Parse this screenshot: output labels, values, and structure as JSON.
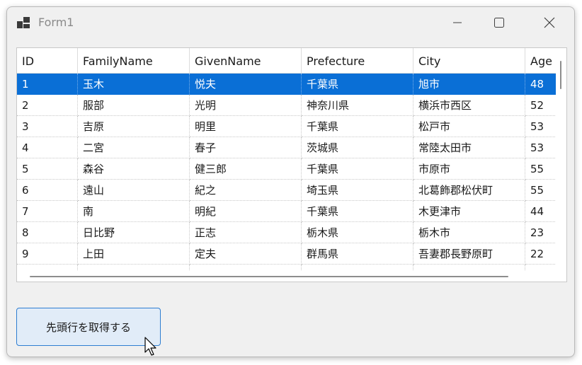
{
  "window": {
    "title": "Form1",
    "controls": [
      "minimize-icon",
      "maximize-icon",
      "close-icon"
    ]
  },
  "grid": {
    "columns": [
      "ID",
      "FamilyName",
      "GivenName",
      "Prefecture",
      "City",
      "Age"
    ],
    "selected_row_index": 0,
    "rows": [
      [
        "1",
        "玉木",
        "悦夫",
        "千葉県",
        "旭市",
        "48"
      ],
      [
        "2",
        "服部",
        "光明",
        "神奈川県",
        "横浜市西区",
        "52"
      ],
      [
        "3",
        "吉原",
        "明里",
        "千葉県",
        "松戸市",
        "53"
      ],
      [
        "4",
        "二宮",
        "春子",
        "茨城県",
        "常陸太田市",
        "53"
      ],
      [
        "5",
        "森谷",
        "健三郎",
        "千葉県",
        "市原市",
        "55"
      ],
      [
        "6",
        "遠山",
        "紀之",
        "埼玉県",
        "北葛飾郡松伏町",
        "55"
      ],
      [
        "7",
        "南",
        "明紀",
        "千葉県",
        "木更津市",
        "44"
      ],
      [
        "8",
        "日比野",
        "正志",
        "栃木県",
        "栃木市",
        "23"
      ],
      [
        "9",
        "上田",
        "定夫",
        "群馬県",
        "吾妻郡長野原町",
        "22"
      ]
    ]
  },
  "button": {
    "label": "先頭行を取得する"
  },
  "colors": {
    "selection": "#0a6fd6",
    "button_bg": "#e1ecf8",
    "button_border": "#2e7dd1"
  }
}
